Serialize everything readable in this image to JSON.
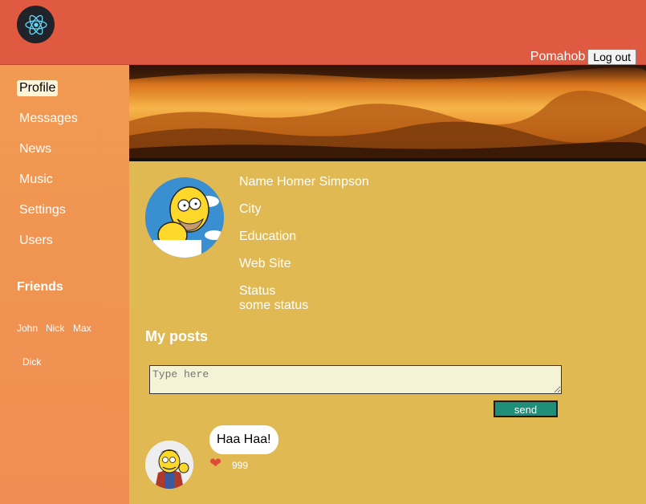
{
  "header": {
    "username": "Pomahob",
    "logout_label": "Log out"
  },
  "sidebar": {
    "items": [
      {
        "label": "Profile",
        "active": true
      },
      {
        "label": "Messages"
      },
      {
        "label": "News"
      },
      {
        "label": "Music"
      },
      {
        "label": "Settings"
      },
      {
        "label": "Users"
      }
    ],
    "friends_title": "Friends",
    "friends": [
      "John",
      "Nick",
      "Max",
      "Dick"
    ]
  },
  "profile": {
    "name": "Name Homer Simpson",
    "city": "City",
    "education": "Education",
    "website": "Web Site",
    "status_label": "Status",
    "status_value": "some status"
  },
  "posts": {
    "title": "My posts",
    "input_placeholder": "Type here",
    "send_label": "send",
    "items": [
      {
        "text": "Haa Haa!",
        "likes": "999"
      }
    ]
  },
  "colors": {
    "header": "#e05a42",
    "sidebar": "#f19a52",
    "content": "#e0b952",
    "send_button": "#1f8f7a",
    "heart": "#e04a3a"
  }
}
